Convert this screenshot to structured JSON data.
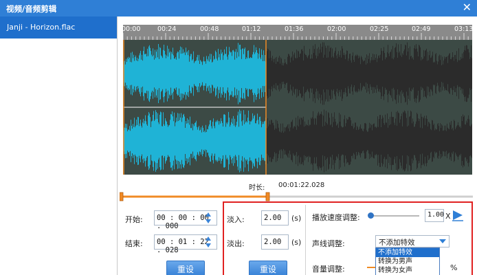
{
  "window": {
    "title": "视频/音频剪辑",
    "close_icon": "close-icon"
  },
  "sidebar": {
    "files": [
      {
        "name": "Janji - Horizon.flac",
        "selected": true
      }
    ]
  },
  "timeline": {
    "labels": [
      "00:00",
      "00:24",
      "00:48",
      "01:12",
      "01:36",
      "02:00",
      "02:25",
      "02:49",
      "03:13"
    ]
  },
  "waveform": {
    "selected_color": "#1fb3d6",
    "unselected_color": "#2b2b2b",
    "background_color": "#3c4a45",
    "marker_color": "#f08a24"
  },
  "duration": {
    "label": "时长:",
    "value": "00:01:22.028"
  },
  "trim": {
    "start_label": "开始:",
    "start_value": "00 : 00 : 00 . 000",
    "end_label": "结束:",
    "end_value": "00 : 01 : 22 . 028",
    "reset_label": "重设"
  },
  "fade": {
    "fade_in_label": "淡入:",
    "fade_in_value": "2.00",
    "fade_out_label": "淡出:",
    "fade_out_value": "2.00",
    "unit": "(s)",
    "reset_label": "重设"
  },
  "effects": {
    "speed_label": "播放速度调整:",
    "speed_value": "1.00",
    "speed_unit": "X",
    "speed_fraction": 0.02,
    "voice_label": "声线调整:",
    "voice_selected": "不添加特效",
    "voice_options": [
      "不添加特效",
      "转换为男声",
      "转换为女声"
    ],
    "volume_label": "音量调整:",
    "volume_unit": "%"
  },
  "colors": {
    "accent": "#2f7fd6",
    "highlight": "#e02020"
  }
}
